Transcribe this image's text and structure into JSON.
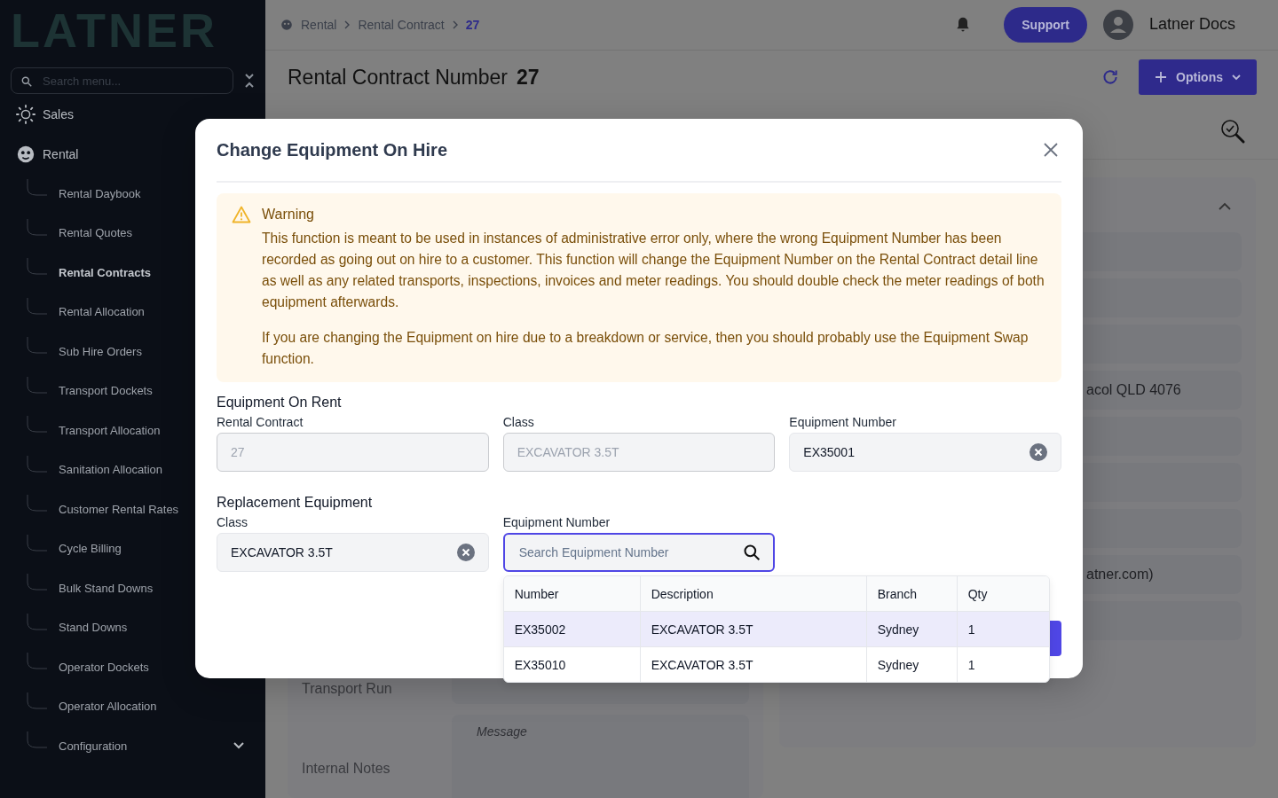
{
  "sidebar": {
    "logo": "LATNER",
    "search": {
      "placeholder": "Search menu..."
    },
    "items": [
      {
        "label": "Sales",
        "kind": "sales"
      },
      {
        "label": "Rental",
        "kind": "rental",
        "children": [
          {
            "label": "Rental Daybook",
            "selected": false
          },
          {
            "label": "Rental Quotes",
            "selected": false
          },
          {
            "label": "Rental Contracts",
            "selected": true
          },
          {
            "label": "Rental Allocation",
            "selected": false
          },
          {
            "label": "Sub Hire Orders",
            "selected": false
          },
          {
            "label": "Transport Dockets",
            "selected": false
          },
          {
            "label": "Transport Allocation",
            "selected": false
          },
          {
            "label": "Sanitation Allocation",
            "selected": false
          },
          {
            "label": "Customer Rental Rates",
            "selected": false
          },
          {
            "label": "Cycle Billing",
            "selected": false
          },
          {
            "label": "Bulk Stand Downs",
            "selected": false
          },
          {
            "label": "Stand Downs",
            "selected": false
          },
          {
            "label": "Operator Dockets",
            "selected": false
          },
          {
            "label": "Operator Allocation",
            "selected": false
          },
          {
            "label": "Configuration",
            "selected": false,
            "kind": "folder"
          }
        ]
      }
    ]
  },
  "breadcrumb": [
    {
      "label": "Rental",
      "current": false
    },
    {
      "label": "Rental Contract",
      "current": false
    },
    {
      "label": "27",
      "current": true
    }
  ],
  "header": {
    "support": "Support",
    "user": "Latner Docs"
  },
  "page": {
    "title": "Rental Contract Number",
    "number": "27",
    "options": "Options"
  },
  "form": {
    "fields": [
      {
        "label": "Transport Run",
        "kind": "input"
      },
      {
        "label": "Internal Notes",
        "kind": "textarea",
        "placeholder": "Message"
      }
    ]
  },
  "side_panel": {
    "rows": [
      {
        "kind": "field"
      },
      {
        "kind": "field"
      },
      {
        "kind": "field"
      },
      {
        "kind": "field",
        "value": "acol QLD 4076"
      },
      {
        "kind": "field"
      },
      {
        "kind": "field"
      },
      {
        "kind": "field"
      },
      {
        "kind": "field",
        "value": "atner.com)"
      },
      {
        "kind": "field"
      }
    ]
  },
  "modal": {
    "title": "Change Equipment On Hire",
    "warning": {
      "title": "Warning",
      "paragraphs": [
        "This function is meant to be used in instances of administrative error only, where the wrong Equipment Number has been recorded as going out on hire to a customer. This function will change the Equipment Number on the Rental Contract detail line as well as any related transports, inspections, invoices and meter readings. You should double check the meter readings of both equipment afterwards.",
        "If you are changing the Equipment on hire due to a breakdown or service, then you should probably use the Equipment Swap function."
      ]
    },
    "sections": [
      {
        "title": "Equipment On Rent",
        "fields": [
          {
            "label": "Rental Contract",
            "kind": "text",
            "value": "27",
            "disabled": true
          },
          {
            "label": "Class",
            "kind": "text",
            "value": "EXCAVATOR 3.5T",
            "disabled": true
          },
          {
            "label": "Equipment Number",
            "kind": "clearable",
            "value": "EX35001",
            "disabled": false
          }
        ]
      },
      {
        "title": "Replacement Equipment",
        "fields": [
          {
            "label": "Class",
            "kind": "clearable",
            "value": "EXCAVATOR 3.5T",
            "disabled": false
          },
          {
            "label": "Equipment Number",
            "kind": "search",
            "placeholder": "Search Equipment Number",
            "disabled": false,
            "focused": true
          }
        ]
      }
    ],
    "dropdown": {
      "columns": [
        "Number",
        "Description",
        "Branch",
        "Qty"
      ],
      "rows": [
        {
          "cells": [
            "EX35002",
            "EXCAVATOR 3.5T",
            "Sydney",
            "1"
          ],
          "selected": true
        },
        {
          "cells": [
            "EX35010",
            "EXCAVATOR 3.5T",
            "Sydney",
            "1"
          ],
          "selected": false
        }
      ]
    }
  }
}
